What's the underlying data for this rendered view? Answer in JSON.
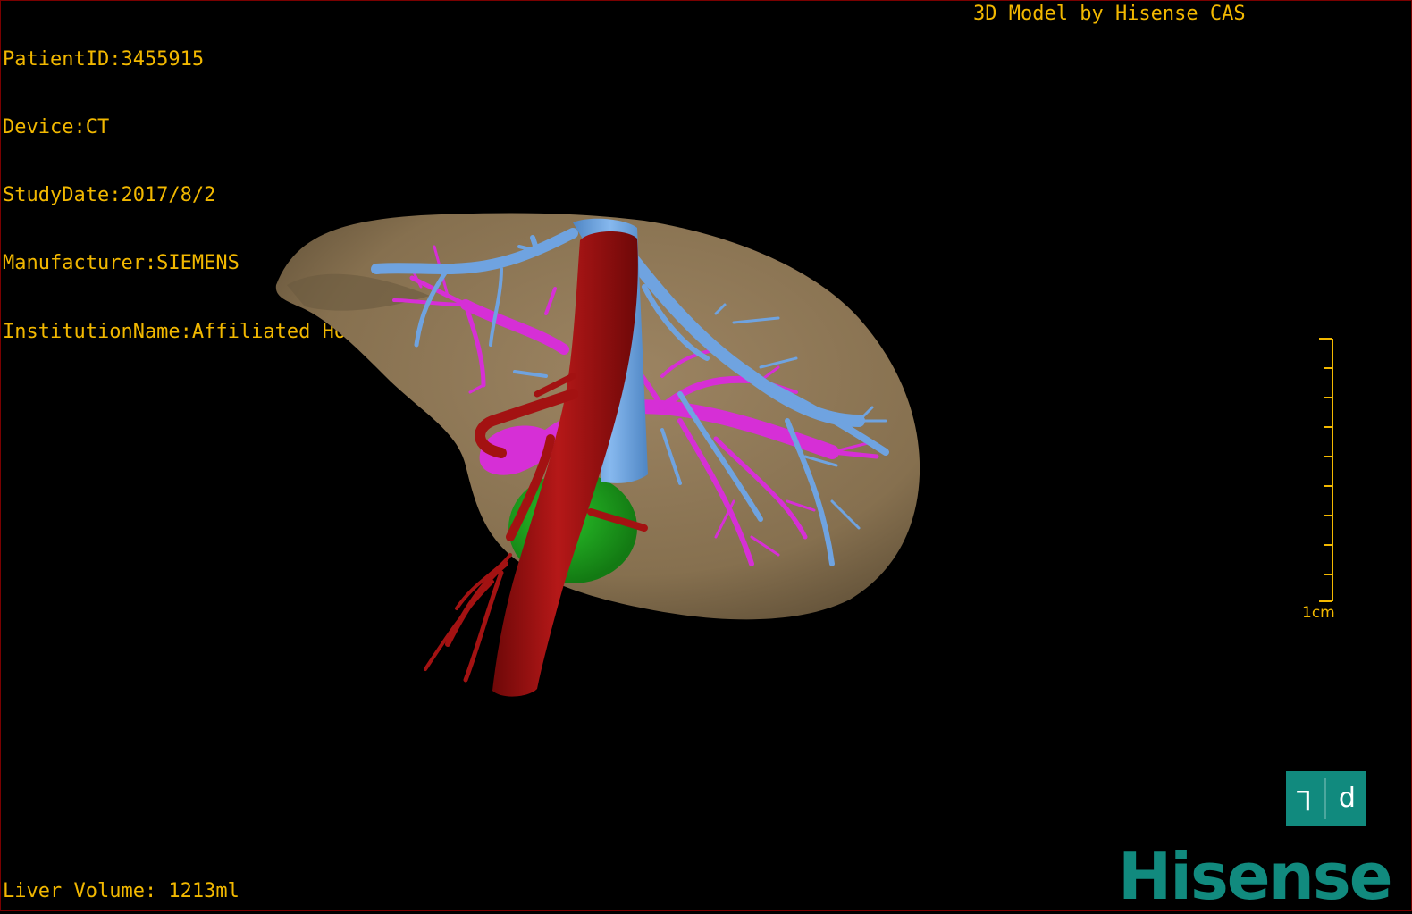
{
  "info": {
    "patient_id": "PatientID:3455915",
    "device": "Device:CT",
    "study_date": "StudyDate:2017/8/2",
    "manufacturer": "Manufacturer:SIEMENS",
    "institution": "InstitutionName:Affiliated Hospital Qingdao University-C"
  },
  "credit": "3D Model by Hisense CAS",
  "volume": "Liver Volume: 1213ml",
  "scale": {
    "label": "1cm"
  },
  "orientation": {
    "left_glyph": "L",
    "right_glyph": "d"
  },
  "logo": "Hisense",
  "colors": {
    "text": "#f2b800",
    "liver": "#8b7355",
    "hepatic_vein": "#6fa3e0",
    "portal_vein": "#d62fd6",
    "artery": "#a31212",
    "gallbladder": "#1c9e1c",
    "brand": "#118a7e"
  }
}
